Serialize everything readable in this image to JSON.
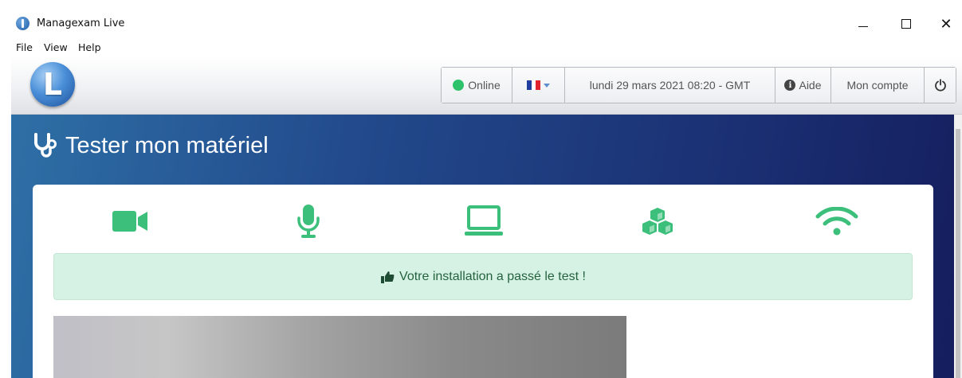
{
  "window": {
    "title": "Managexam Live",
    "controls": {
      "minimize_icon": "minimize-icon",
      "maximize_icon": "maximize-icon",
      "close_label": "✕"
    }
  },
  "menu": {
    "items": [
      "File",
      "View",
      "Help"
    ]
  },
  "header": {
    "logo_letter": "L",
    "status_label": "Online",
    "status_color": "#2ec26a",
    "language_flag": "france-flag-icon",
    "datetime": "lundi 29 mars 2021 08:20 - GMT",
    "help_label": "Aide",
    "account_label": "Mon compte",
    "power_icon": "power-icon"
  },
  "main": {
    "heading": "Tester mon matériel",
    "heading_icon": "stethoscope-icon",
    "accent_color": "#3bbf7a",
    "tests": [
      {
        "name": "camera-icon"
      },
      {
        "name": "microphone-icon"
      },
      {
        "name": "laptop-icon"
      },
      {
        "name": "cubes-icon"
      },
      {
        "name": "wifi-icon"
      }
    ],
    "success_message": "Votre installation a passé le test !",
    "success_icon": "thumbs-up-icon"
  }
}
